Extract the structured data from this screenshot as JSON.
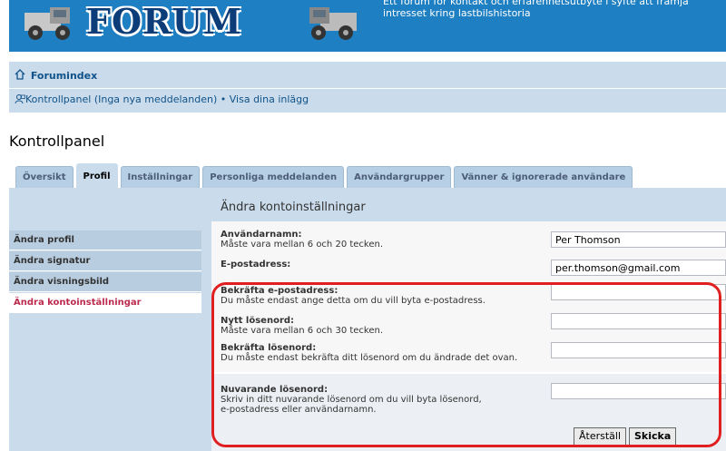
{
  "header": {
    "logo_text": "FORUM",
    "tagline": "Ett forum för kontakt och erfarenhetsutbyte i syfte att främja intresset kring lastbilshistoria"
  },
  "navbar": {
    "home_label": "Forumindex",
    "user_control_panel": "Kontrollpanel (Inga nya meddelanden)",
    "separator": "•",
    "view_posts": "Visa dina inlägg"
  },
  "page_title": "Kontrollpanel",
  "tabs": [
    {
      "label": "Översikt",
      "active": false
    },
    {
      "label": "Profil",
      "active": true
    },
    {
      "label": "Inställningar",
      "active": false
    },
    {
      "label": "Personliga meddelanden",
      "active": false
    },
    {
      "label": "Användargrupper",
      "active": false
    },
    {
      "label": "Vänner & ignorerade användare",
      "active": false
    }
  ],
  "menu": [
    {
      "label": "Ändra profil",
      "active": false
    },
    {
      "label": "Ändra signatur",
      "active": false
    },
    {
      "label": "Ändra visningsbild",
      "active": false
    },
    {
      "label": "Ändra kontoinställningar",
      "active": true
    }
  ],
  "form": {
    "title": "Ändra kontoinställningar",
    "username": {
      "label": "Användarnamn:",
      "desc": "Måste vara mellan 6 och 20 tecken.",
      "value": "Per Thomson"
    },
    "email": {
      "label": "E-postadress:",
      "value": "per.thomson@gmail.com"
    },
    "confirm_email": {
      "label": "Bekräfta e-postadress:",
      "desc": "Du måste endast ange detta om du vill byta e-postadress.",
      "value": ""
    },
    "new_password": {
      "label": "Nytt lösenord:",
      "desc": "Måste vara mellan 6 och 30 tecken.",
      "value": ""
    },
    "confirm_password": {
      "label": "Bekräfta lösenord:",
      "desc": "Du måste endast bekräfta ditt lösenord om du ändrade det ovan.",
      "value": ""
    },
    "current_password": {
      "label": "Nuvarande lösenord:",
      "desc_line1": "Skriv in ditt nuvarande lösenord om du vill byta lösenord,",
      "desc_line2": "e-postadress eller användarnamn.",
      "value": ""
    },
    "reset_label": "Återställ",
    "submit_label": "Skicka"
  },
  "colors": {
    "header_bg": "#1e7fc2",
    "logo": "#0c3d78",
    "panel_bg": "#cadceb",
    "active_menu_text": "#bc2a4d",
    "highlight": "#e02020"
  }
}
